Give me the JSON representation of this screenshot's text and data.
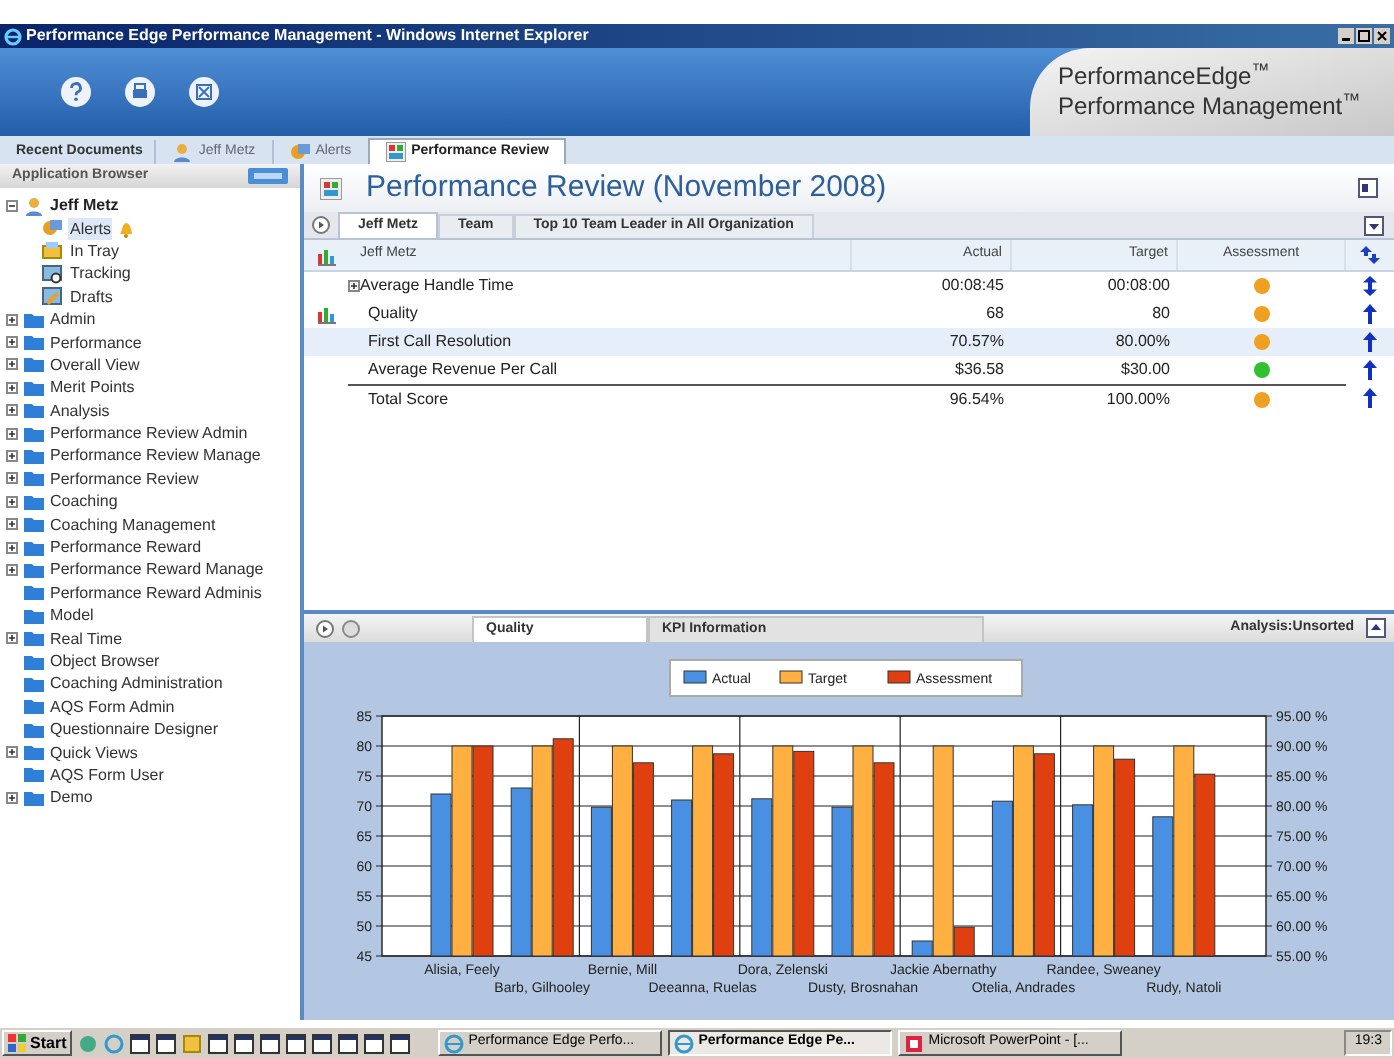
{
  "window": {
    "title": "Performance Edge Performance Management - Windows Internet Explorer"
  },
  "header": {
    "brand": [
      "PerformanceEdge$^{™}$",
      "Performance Management$^{™}$"
    ]
  },
  "doc_tabs_label": "Recent Documents",
  "doc_tabs": [
    {
      "label": "Jeff Metz",
      "kind": "user",
      "selected": false
    },
    {
      "label": "Alerts",
      "kind": "alert",
      "selected": false
    },
    {
      "label": "Performance Review",
      "kind": "report",
      "selected": true
    }
  ],
  "sidebar": {
    "title": "Application Browser",
    "tree": [
      {
        "label": "Jeff Metz",
        "kind": "user",
        "expanded": true,
        "children": [
          {
            "label": "Alerts",
            "kind": "alert",
            "selected": true,
            "notification": true
          },
          {
            "label": "In Tray",
            "kind": "tray",
            "selected": false,
            "notification": false
          },
          {
            "label": "Tracking",
            "kind": "tracking",
            "selected": false,
            "notification": false
          },
          {
            "label": "Drafts",
            "kind": "drafts",
            "selected": false,
            "notification": false
          }
        ]
      },
      {
        "label": "Admin",
        "kind": "folder",
        "expandable": true
      },
      {
        "label": "Performance",
        "kind": "folder",
        "expandable": true
      },
      {
        "label": "Overall View",
        "kind": "folder",
        "expandable": true
      },
      {
        "label": "Merit Points",
        "kind": "folder",
        "expandable": true
      },
      {
        "label": "Analysis",
        "kind": "folder",
        "expandable": true
      },
      {
        "label": "Performance Review Admin",
        "kind": "folder",
        "expandable": true
      },
      {
        "label": "Performance Review Manage",
        "kind": "folder",
        "expandable": true
      },
      {
        "label": "Performance Review",
        "kind": "folder",
        "expandable": true
      },
      {
        "label": "Coaching",
        "kind": "folder",
        "expandable": true
      },
      {
        "label": "Coaching Management",
        "kind": "folder",
        "expandable": true
      },
      {
        "label": "Performance Reward",
        "kind": "folder",
        "expandable": true
      },
      {
        "label": "Performance Reward Manage",
        "kind": "folder",
        "expandable": true
      },
      {
        "label": "Performance Reward Adminis",
        "kind": "folder",
        "expandable": false
      },
      {
        "label": "Model",
        "kind": "folder",
        "expandable": false
      },
      {
        "label": "Real Time",
        "kind": "folder",
        "expandable": true
      },
      {
        "label": "Object Browser",
        "kind": "folder",
        "expandable": false
      },
      {
        "label": "Coaching Administration",
        "kind": "folder",
        "expandable": false
      },
      {
        "label": "AQS Form Admin",
        "kind": "folder",
        "expandable": false
      },
      {
        "label": "Questionnaire Designer",
        "kind": "folder",
        "expandable": false
      },
      {
        "label": "Quick Views",
        "kind": "folder",
        "expandable": true
      },
      {
        "label": "AQS Form User",
        "kind": "folder",
        "expandable": false
      },
      {
        "label": "Demo",
        "kind": "folder",
        "expandable": true
      }
    ]
  },
  "main": {
    "title": "Performance Review (November 2008)",
    "tabs": [
      {
        "label": "Jeff Metz",
        "selected": true
      },
      {
        "label": "Team",
        "selected": false
      },
      {
        "label": "Top 10 Team Leader in All Organization",
        "selected": false
      }
    ],
    "table": {
      "columns": [
        "Jeff Metz",
        "Actual",
        "Target",
        "Assessment"
      ],
      "rows": [
        {
          "kind": "metric",
          "label": "Average Handle Time",
          "actual": "00:08:45",
          "target": "00:08:00",
          "color": "#f0a020",
          "two_way": true,
          "expandable": true,
          "chart": false,
          "selected": false
        },
        {
          "kind": "metric",
          "label": "Quality",
          "actual": "68",
          "target": "80",
          "color": "#f0a020",
          "two_way": false,
          "expandable": false,
          "chart": true,
          "selected": false
        },
        {
          "kind": "metric",
          "label": "First Call Resolution",
          "actual": "70.57%",
          "target": "80.00%",
          "color": "#f0a020",
          "two_way": false,
          "expandable": false,
          "chart": false,
          "selected": true
        },
        {
          "kind": "metric",
          "label": "Average Revenue Per Call",
          "actual": "$36.58",
          "target": "$30.00",
          "color": "#30c030",
          "two_way": false,
          "expandable": false,
          "chart": false,
          "selected": false
        },
        {
          "kind": "total",
          "label": "Total Score",
          "actual": "96.54%",
          "target": "100.00%",
          "color": "#f0a020",
          "two_way": false,
          "expandable": false,
          "chart": false,
          "selected": false
        }
      ]
    }
  },
  "analysis": {
    "tabs": [
      {
        "label": "Quality",
        "selected": true
      },
      {
        "label": "KPI Information",
        "selected": false
      }
    ],
    "sort_label": "Analysis:Unsorted",
    "chart_data": {
      "type": "bar",
      "grid": true,
      "legend": true,
      "categories": [
        "Alisia, Feely",
        "Barb, Gilhooley",
        "Bernie, Mill",
        "Deeanna, Ruelas",
        "Dora, Zelenski",
        "Dusty, Brosnahan",
        "Jackie Abernathy",
        "Otelia, Andrades",
        "Randee, Sweaney",
        "Rudy, Natoli"
      ],
      "series": [
        {
          "name": "Actual",
          "color": "#4a90e2",
          "values": [
            72,
            73,
            69.8,
            71,
            71.2,
            69.8,
            47.5,
            70.8,
            70.2,
            68.2
          ]
        },
        {
          "name": "Target",
          "color": "#ffb040",
          "values": [
            80,
            80,
            80,
            80,
            80,
            80,
            80,
            80,
            80,
            80
          ]
        },
        {
          "name": "Assessment",
          "color": "#e04010",
          "values": [
            80,
            81.2,
            77.2,
            78.7,
            79.1,
            77.2,
            49.8,
            78.7,
            77.8,
            75.3
          ]
        }
      ],
      "ylim": [
        45,
        85
      ],
      "yticks": [
        45,
        50,
        55,
        60,
        65,
        70,
        75,
        80,
        85
      ],
      "y2ticks": [
        "55.00 %",
        "60.00 %",
        "65.00 %",
        "70.00 %",
        "75.00 %",
        "80.00 %",
        "85.00 %",
        "90.00 %",
        "95.00 %"
      ]
    }
  },
  "taskbar": {
    "start": "Start",
    "tasks": [
      {
        "label": "Performance Edge Perfo...",
        "kind": "browser",
        "selected": false
      },
      {
        "label": "Performance Edge Pe...",
        "kind": "browser",
        "selected": true
      },
      {
        "label": "Microsoft PowerPoint - [...",
        "kind": "slides",
        "selected": false
      }
    ],
    "clock": "19:3"
  }
}
